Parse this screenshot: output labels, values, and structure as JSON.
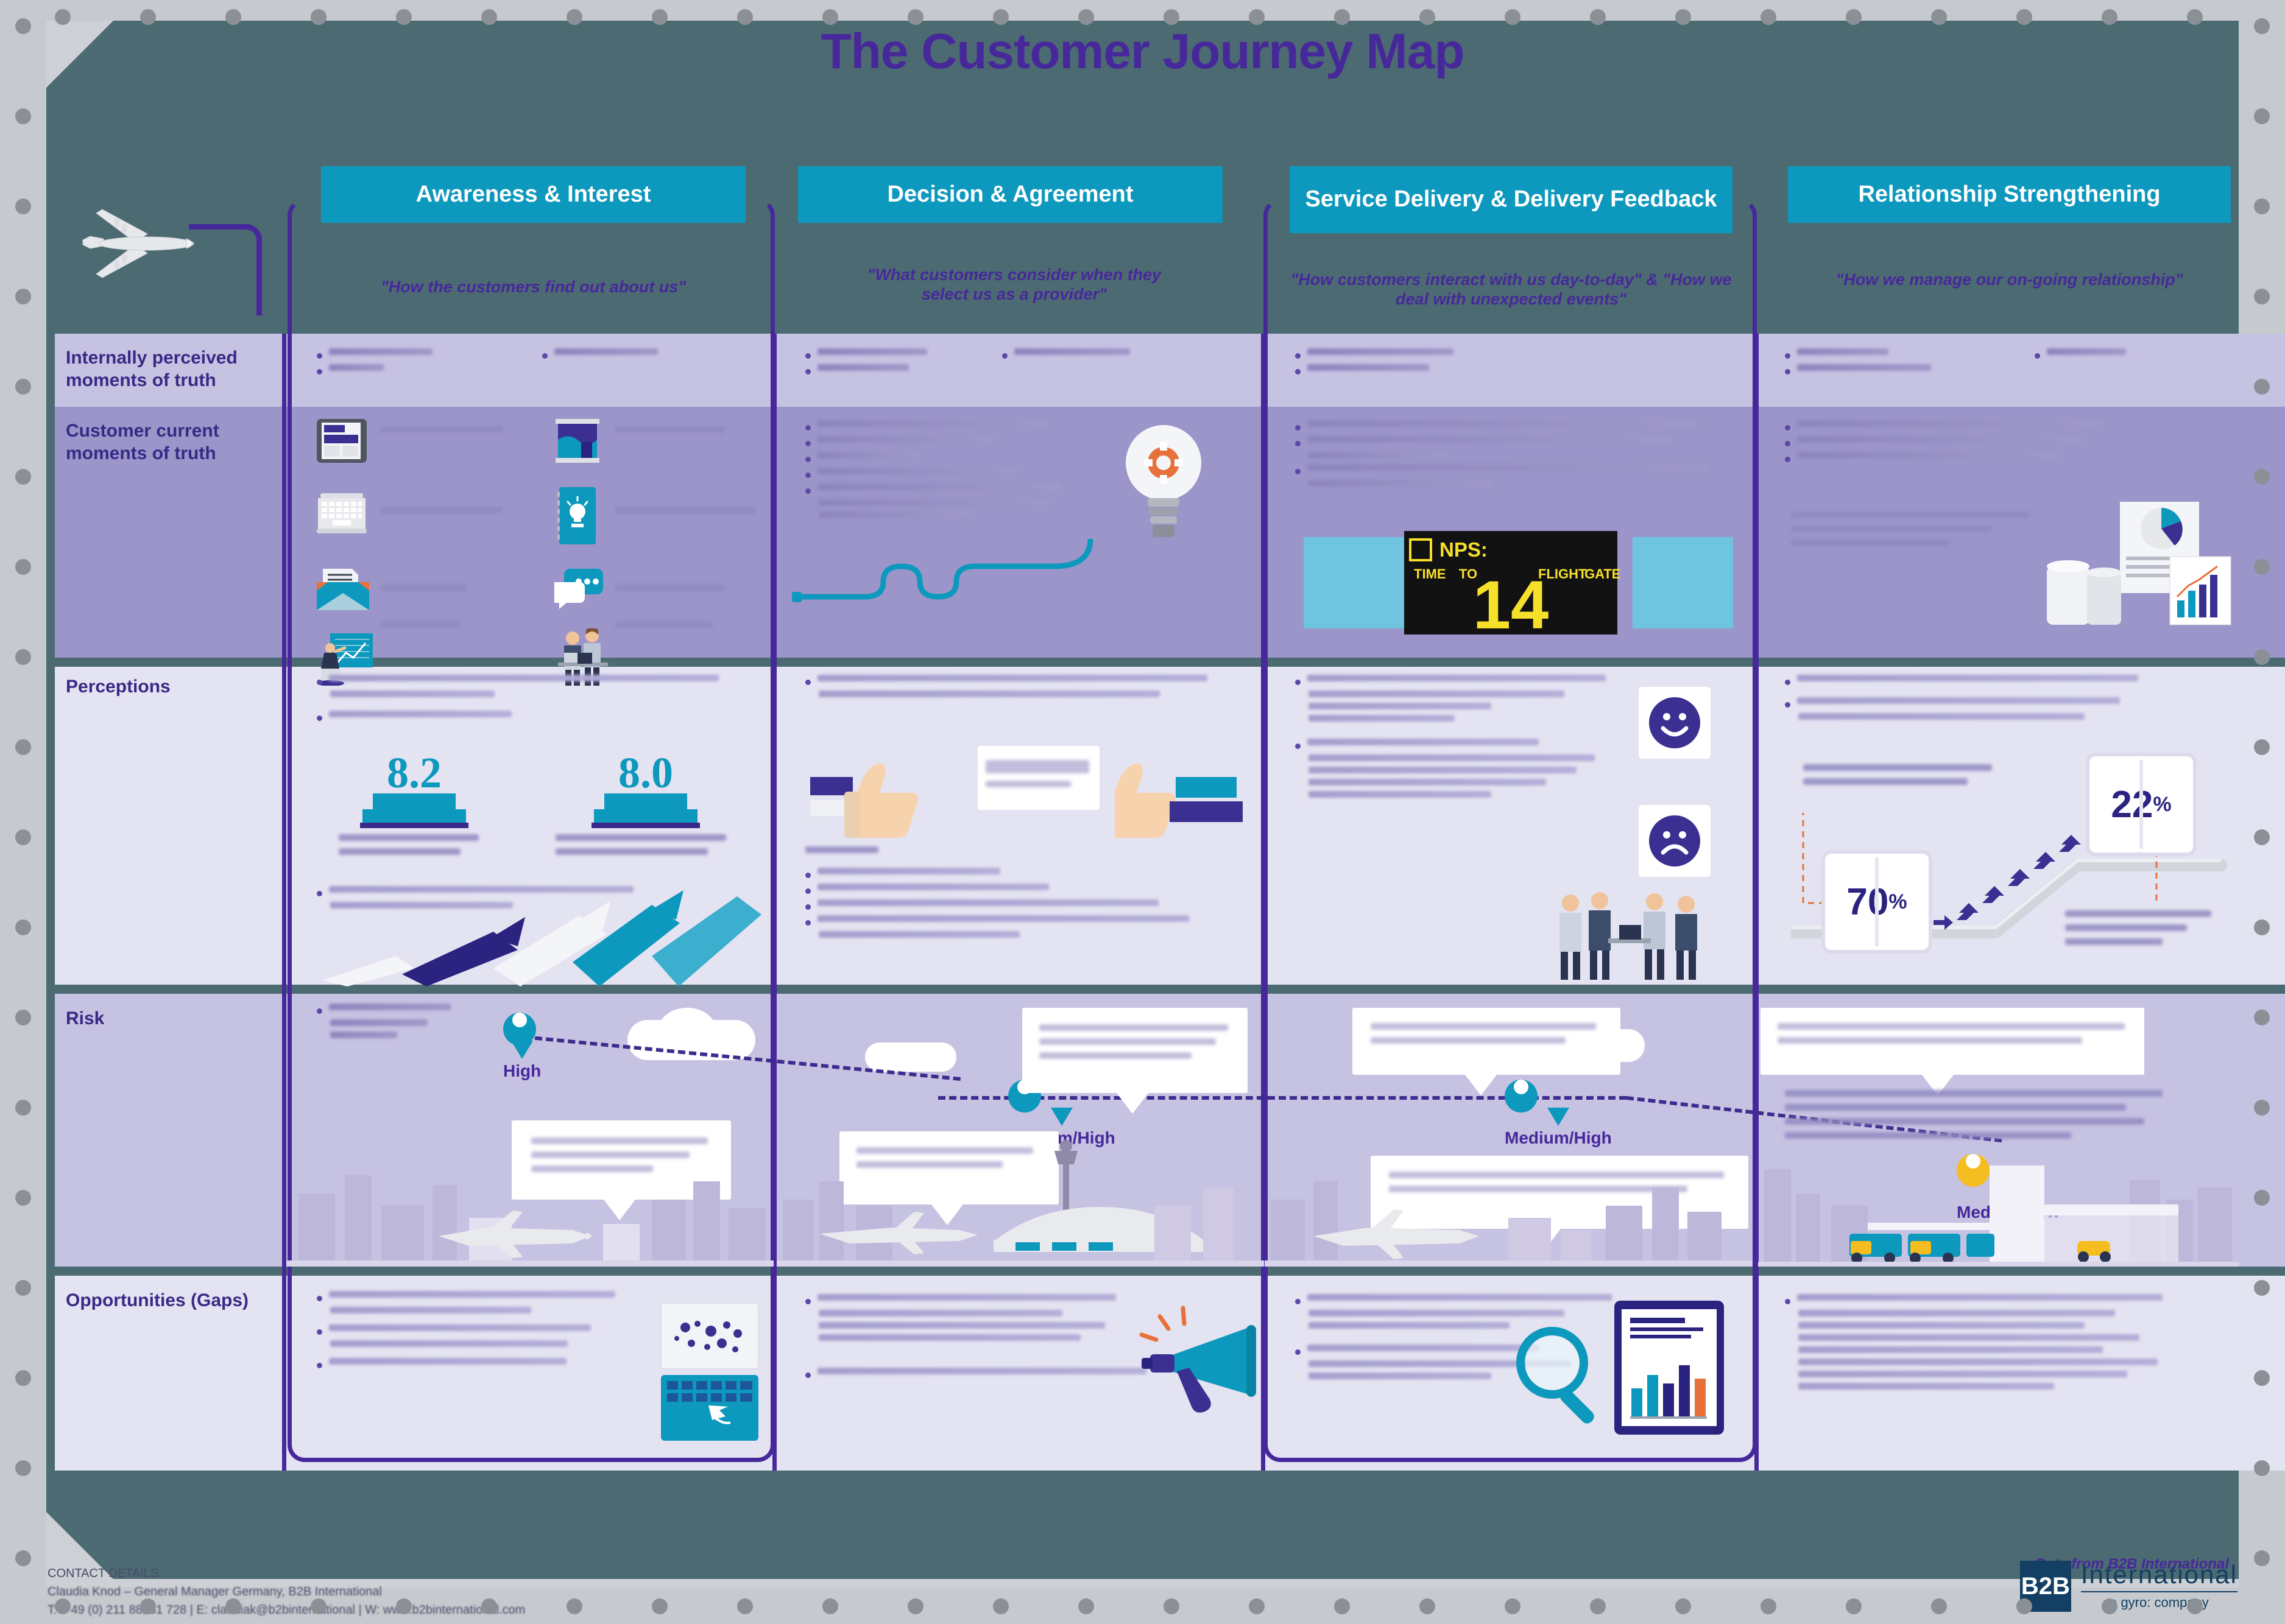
{
  "title": "The Customer Journey Map",
  "columns": [
    {
      "id": "awareness",
      "header": "Awareness & Interest",
      "subtitle": "\"How the customers find out about us\""
    },
    {
      "id": "decision",
      "header": "Decision & Agreement",
      "subtitle": "\"What customers consider when they select us as a provider\""
    },
    {
      "id": "service",
      "header": "Service Delivery & Delivery Feedback",
      "subtitle": "\"How customers interact with us day-to-day\" & \"How we deal with unexpected events\""
    },
    {
      "id": "relationship",
      "header": "Relationship Strengthening",
      "subtitle": "\"How we manage our on-going relationship\""
    }
  ],
  "rows": [
    {
      "id": "internal",
      "label": "Internally perceived moments of truth"
    },
    {
      "id": "customer",
      "label": "Customer current moments of truth"
    },
    {
      "id": "perceptions",
      "label": "Perceptions"
    },
    {
      "id": "risk",
      "label": "Risk"
    },
    {
      "id": "opportunities",
      "label": "Opportunities (Gaps)"
    }
  ],
  "metrics": {
    "nps_label": "NPS:",
    "nps_value": "14",
    "board_columns": [
      "TIME",
      "TO",
      "FLIGHT",
      "GATE"
    ],
    "score_left": "8.2",
    "score_right": "8.0",
    "pct_left_value": "70",
    "pct_left_symbol": "%",
    "pct_right_value": "22",
    "pct_right_symbol": "%"
  },
  "risk_levels": [
    {
      "column": "awareness",
      "label": "High",
      "color": "#0d98bd"
    },
    {
      "column": "decision",
      "label": "Medium/High",
      "color": "#0d98bd"
    },
    {
      "column": "service",
      "label": "Medium/High",
      "color": "#0d98bd"
    },
    {
      "column": "relationship",
      "label": "Medium/Low",
      "color": "#f5bd1f"
    }
  ],
  "icons_customer_moments": [
    "tablet-website-icon",
    "exhibition-stand-icon",
    "laptop-icon",
    "notebook-idea-icon",
    "email-envelope-icon",
    "chat-bubbles-icon",
    "presenter-icon",
    "meeting-people-icon"
  ],
  "attribution": "Data from B2B International",
  "footer": {
    "heading": "CONTACT DETAILS:",
    "line1": "Claudia Knod – General Manager Germany, B2B International",
    "line2": "T: + 49 (0) 211 88231 728  |  E: claudiak@b2binternational  |  W: www.b2binternational.com"
  },
  "logo": {
    "mark": "B2B",
    "name": "International",
    "tagline": "a gyro: company"
  },
  "colors": {
    "accent_teal": "#0d98bd",
    "accent_purple": "#47289b",
    "panel_slate": "#4c6a72",
    "band_light": "#e4e3f1",
    "band_mid": "#c6c2e2",
    "band_dark": "#9b95c9",
    "pin_gold": "#f5bd1f",
    "board_yellow": "#f6e02a"
  }
}
